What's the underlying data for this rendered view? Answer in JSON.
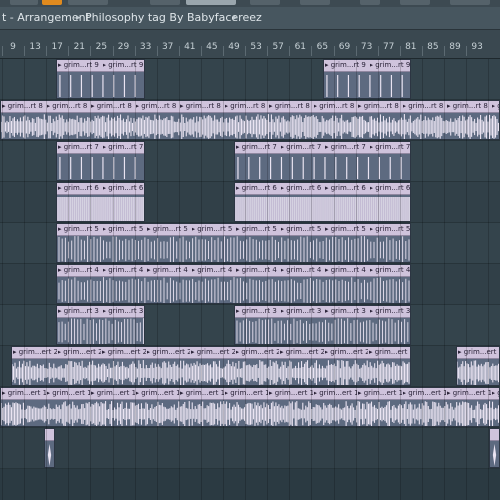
{
  "titlebar": {
    "window_title": "t - Arrangement",
    "playlist_name": "Philosophy tag By Babyfacereez",
    "separator": "▸"
  },
  "ruler": {
    "bar_numbers": [
      "9",
      "13",
      "17",
      "21",
      "25",
      "29",
      "33",
      "37",
      "41",
      "45",
      "49",
      "53",
      "57",
      "61",
      "65",
      "69",
      "73",
      "77",
      "81",
      "85",
      "89",
      "93"
    ]
  },
  "tracks": [
    {
      "clip_label": "grim...rt 9",
      "pattern": "spikes"
    },
    {
      "clip_label": "grim...rt 8",
      "pattern": "dense"
    },
    {
      "clip_label": "grim...rt 7",
      "pattern": "spikes"
    },
    {
      "clip_label": "grim...rt 6",
      "pattern": "block"
    },
    {
      "clip_label": "grim...rt 5",
      "pattern": "lines"
    },
    {
      "clip_label": "grim...rt 4",
      "pattern": "lines"
    },
    {
      "clip_label": "grim...rt 3",
      "pattern": "lines"
    },
    {
      "clip_label": "grim...ert 2",
      "pattern": "dense"
    },
    {
      "clip_label": "grim...ert 1",
      "pattern": "dense"
    },
    {
      "clip_label": "",
      "pattern": "blip"
    }
  ],
  "colors": {
    "background": "#2b3a42",
    "clip_header": "#cfc3dc",
    "clip_body": "#5d6a80",
    "waveform": "#eae4f2"
  }
}
